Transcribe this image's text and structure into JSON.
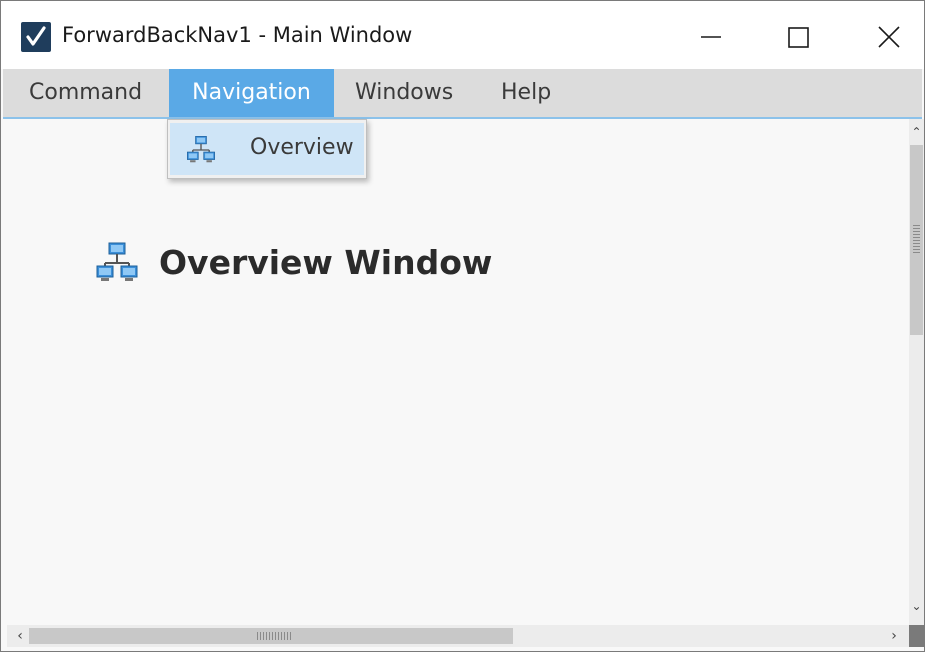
{
  "window": {
    "title": "ForwardBackNav1 - Main Window",
    "icon": "checkmark-app-icon",
    "controls": [
      "minimize-icon",
      "maximize-icon",
      "close-icon"
    ]
  },
  "menubar": {
    "items": [
      {
        "label": "Command"
      },
      {
        "label": "Navigation",
        "active": true
      },
      {
        "label": "Windows"
      },
      {
        "label": "Help"
      }
    ]
  },
  "dropdown": {
    "items": [
      {
        "label": "Overview",
        "icon": "network-icon"
      }
    ]
  },
  "content": {
    "header_title": "Overview Window",
    "header_icon": "network-icon"
  },
  "colors": {
    "menu_active_bg": "#5aa9e6",
    "dropdown_hover_bg": "#cfe5f7",
    "menubar_bg": "#dcdcdc",
    "app_icon_bg": "#1f3d5c"
  }
}
